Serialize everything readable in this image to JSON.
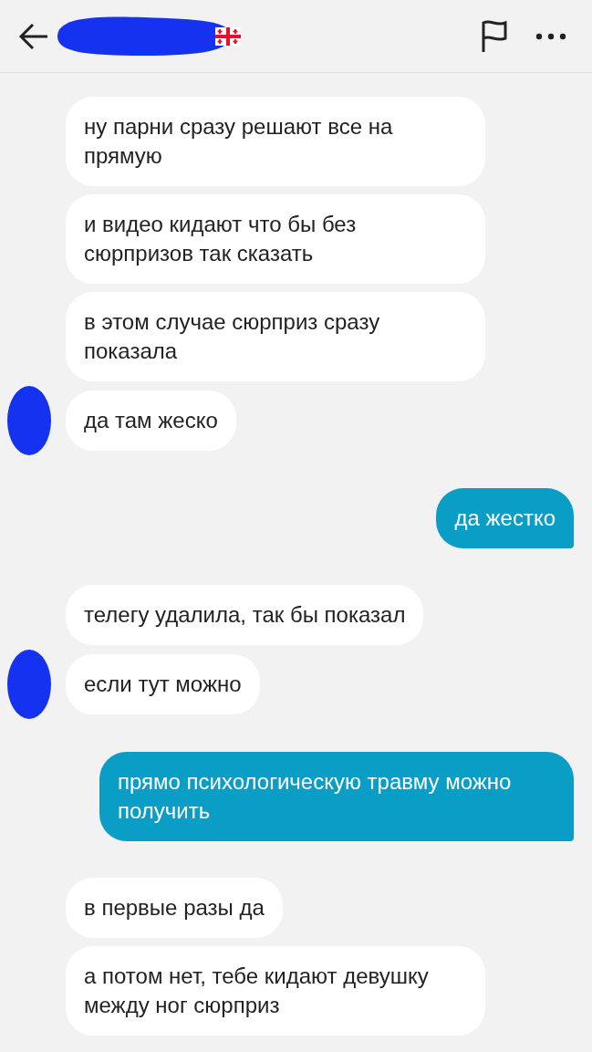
{
  "groups": [
    {
      "kind": "incoming",
      "messages": [
        {
          "text": "ну парни сразу решают все на прямую",
          "avatar": false
        },
        {
          "text": "и видео кидают что бы без сюрпризов так сказать",
          "avatar": false
        },
        {
          "text": "в этом случае сюрприз сразу показала",
          "avatar": false
        },
        {
          "text": "да там жеско",
          "avatar": true
        }
      ]
    },
    {
      "kind": "outgoing",
      "messages": [
        {
          "text": "да жестко"
        }
      ]
    },
    {
      "kind": "incoming",
      "messages": [
        {
          "text": "телегу удалила, так бы показал",
          "avatar": false
        },
        {
          "text": "если тут можно",
          "avatar": true
        }
      ]
    },
    {
      "kind": "outgoing",
      "messages": [
        {
          "text": "прямо психологическую травму можно получить"
        }
      ]
    },
    {
      "kind": "incoming",
      "messages": [
        {
          "text": "в первые разы да",
          "avatar": false
        },
        {
          "text": "а потом нет, тебе кидают девушку между ног сюрприз",
          "avatar": false
        }
      ]
    }
  ]
}
